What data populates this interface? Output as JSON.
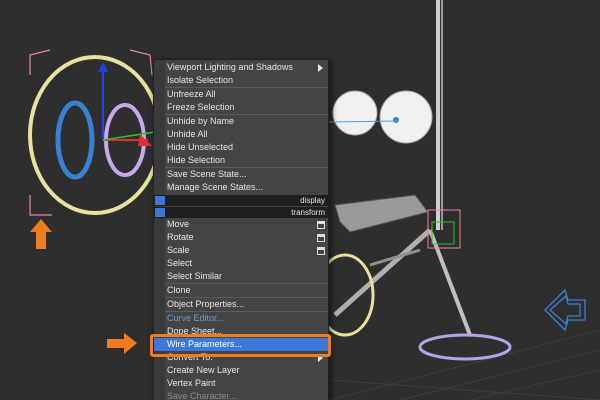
{
  "quad_menu": {
    "items": [
      {
        "label": "Viewport Lighting and Shadows",
        "submenu": true
      },
      {
        "label": "Isolate Selection"
      },
      {
        "label": "Unfreeze All"
      },
      {
        "label": "Freeze Selection"
      },
      {
        "label": "Unhide by Name"
      },
      {
        "label": "Unhide All"
      },
      {
        "label": "Hide Unselected"
      },
      {
        "label": "Hide Selection"
      },
      {
        "label": "Save Scene State..."
      },
      {
        "label": "Manage Scene States..."
      },
      {
        "label": "Move",
        "options_box": true
      },
      {
        "label": "Rotate",
        "options_box": true
      },
      {
        "label": "Scale",
        "options_box": true
      },
      {
        "label": "Select"
      },
      {
        "label": "Select Similar"
      },
      {
        "label": "Clone"
      },
      {
        "label": "Object Properties..."
      },
      {
        "label": "Curve Editor..."
      },
      {
        "label": "Dope Sheet..."
      },
      {
        "label": "Wire Parameters...",
        "highlighted": true
      },
      {
        "label": "Convert To:",
        "submenu": true
      },
      {
        "label": "Create New Layer"
      },
      {
        "label": "Vertex Paint"
      },
      {
        "label": "Save Character...",
        "disabled": true
      }
    ],
    "quadrant_labels": {
      "display": "display",
      "transform": "transform"
    }
  },
  "colors": {
    "viewport_bg": "#2e2e2e",
    "menu_bg": "#444444",
    "highlight": "#3b78d8",
    "annotation_orange": "#f07c20",
    "gizmo_x": "#e03030",
    "gizmo_y": "#30c030",
    "gizmo_z": "#2040e0",
    "selection_brackets": "#f0809a"
  },
  "icons": [
    "arrow-right-annotation-icon",
    "arrow-up-annotation-icon",
    "move-gizmo-icon",
    "submenu-arrow-icon",
    "options-box-icon"
  ]
}
